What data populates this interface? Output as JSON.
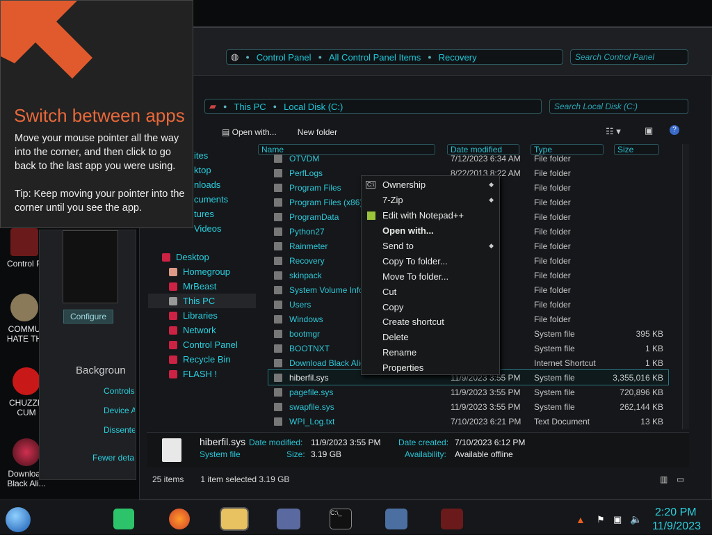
{
  "tip": {
    "title": "Switch between apps",
    "body": "Move your mouse pointer all the way into the corner, and then click to go back to the last app you were using.",
    "tip_line": "Tip: Keep moving your pointer into the corner until you see the app."
  },
  "desktop": {
    "icons": [
      {
        "label": "Control P"
      },
      {
        "label": "COMMU HATE TH"
      },
      {
        "label": "CHUZZIN CUM"
      },
      {
        "label": "Download Black Ali..."
      }
    ]
  },
  "gadget": {
    "configure_label": "Configure"
  },
  "control_panel": {
    "breadcrumb": [
      "Control Panel",
      "All Control Panel Items",
      "Recovery"
    ],
    "search_placeholder": "Search Control Panel"
  },
  "explorer": {
    "breadcrumb": [
      "This PC",
      "Local Disk (C:)"
    ],
    "search_placeholder": "Search Local Disk (C:)",
    "toolbar": {
      "open_with": "Open with...",
      "new_folder": "New folder"
    },
    "nav_partial": [
      "ites",
      "ktop",
      "nloads",
      "cuments",
      "tures",
      "Videos"
    ],
    "nav": [
      {
        "label": "Desktop"
      },
      {
        "label": "Homegroup"
      },
      {
        "label": "MrBeast"
      },
      {
        "label": "This PC"
      },
      {
        "label": "Libraries"
      },
      {
        "label": "Network"
      },
      {
        "label": "Control Panel"
      },
      {
        "label": "Recycle Bin"
      },
      {
        "label": "FLASH !"
      }
    ],
    "under_nav": {
      "background": "Backgroun",
      "controls": "Controls",
      "device": "Device A",
      "dissente": "Dissente",
      "fewer": "Fewer deta"
    },
    "columns": {
      "name": "Name",
      "date": "Date modified",
      "type": "Type",
      "size": "Size"
    },
    "files": [
      {
        "name": "OTVDM",
        "date": "7/12/2023 6:34 AM",
        "type": "File folder",
        "size": ""
      },
      {
        "name": "PerfLogs",
        "date": "8/22/2013 8:22 AM",
        "type": "File folder",
        "size": ""
      },
      {
        "name": "Program Files",
        "date": "AM",
        "type": "File folder",
        "size": ""
      },
      {
        "name": "Program Files (x86)",
        "date": "AM",
        "type": "File folder",
        "size": ""
      },
      {
        "name": "ProgramData",
        "date": "AM",
        "type": "File folder",
        "size": ""
      },
      {
        "name": "Python27",
        "date": "AM",
        "type": "File folder",
        "size": ""
      },
      {
        "name": "Rainmeter",
        "date": "AM",
        "type": "File folder",
        "size": ""
      },
      {
        "name": "Recovery",
        "date": "AM",
        "type": "File folder",
        "size": ""
      },
      {
        "name": "skinpack",
        "date": "PM",
        "type": "File folder",
        "size": ""
      },
      {
        "name": "System Volume Inform",
        "date": "AM",
        "type": "File folder",
        "size": ""
      },
      {
        "name": "Users",
        "date": "AM",
        "type": "File folder",
        "size": ""
      },
      {
        "name": "Windows",
        "date": "AM",
        "type": "File folder",
        "size": ""
      },
      {
        "name": "bootmgr",
        "date": "PM",
        "type": "System file",
        "size": "395 KB"
      },
      {
        "name": "BOOTNXT",
        "date": "AM",
        "type": "System file",
        "size": "1 KB"
      },
      {
        "name": "Download Black Alien",
        "date": "AM",
        "type": "Internet Shortcut",
        "size": "1 KB"
      },
      {
        "name": "hiberfil.sys",
        "date": "11/9/2023 3:55 PM",
        "type": "System file",
        "size": "3,355,016 KB"
      },
      {
        "name": "pagefile.sys",
        "date": "11/9/2023 3:55 PM",
        "type": "System file",
        "size": "720,896 KB"
      },
      {
        "name": "swapfile.sys",
        "date": "11/9/2023 3:55 PM",
        "type": "System file",
        "size": "262,144 KB"
      },
      {
        "name": "WPI_Log.txt",
        "date": "7/10/2023 6:21 PM",
        "type": "Text Document",
        "size": "13 KB"
      }
    ],
    "details": {
      "filename": "hiberfil.sys",
      "filetype": "System file",
      "date_modified_label": "Date modified:",
      "date_modified": "11/9/2023 3:55 PM",
      "size_label": "Size:",
      "size": "3.19 GB",
      "date_created_label": "Date created:",
      "date_created": "7/10/2023 6:12 PM",
      "availability_label": "Availability:",
      "availability": "Available offline"
    },
    "status": {
      "items": "25 items",
      "selected": "1 item selected  3.19 GB"
    }
  },
  "context_menu": [
    {
      "label": "Ownership",
      "submenu": true,
      "bold": false
    },
    {
      "label": "7-Zip",
      "submenu": true,
      "bold": false
    },
    {
      "label": "Edit with Notepad++",
      "submenu": false,
      "bold": false
    },
    {
      "label": "Open with...",
      "submenu": false,
      "bold": true
    },
    {
      "label": "Send to",
      "submenu": true,
      "bold": false
    },
    {
      "label": "Copy To folder...",
      "submenu": false,
      "bold": false
    },
    {
      "label": "Move To folder...",
      "submenu": false,
      "bold": false
    },
    {
      "label": "Cut",
      "submenu": false,
      "bold": false
    },
    {
      "label": "Copy",
      "submenu": false,
      "bold": false
    },
    {
      "label": "Create shortcut",
      "submenu": false,
      "bold": false
    },
    {
      "label": "Delete",
      "submenu": false,
      "bold": false
    },
    {
      "label": "Rename",
      "submenu": false,
      "bold": false
    },
    {
      "label": "Properties",
      "submenu": false,
      "bold": false
    }
  ],
  "taskbar": {
    "time": "2:20 PM",
    "date": "11/9/2023",
    "icons": [
      "start-orb-icon",
      "notes-app-icon",
      "firefox-icon",
      "file-explorer-icon",
      "control-panel-icon",
      "command-prompt-icon",
      "monitor-icon",
      "alien-icon"
    ]
  },
  "colors": {
    "accent": "#1fc7d9",
    "tip_title": "#e8683a"
  }
}
